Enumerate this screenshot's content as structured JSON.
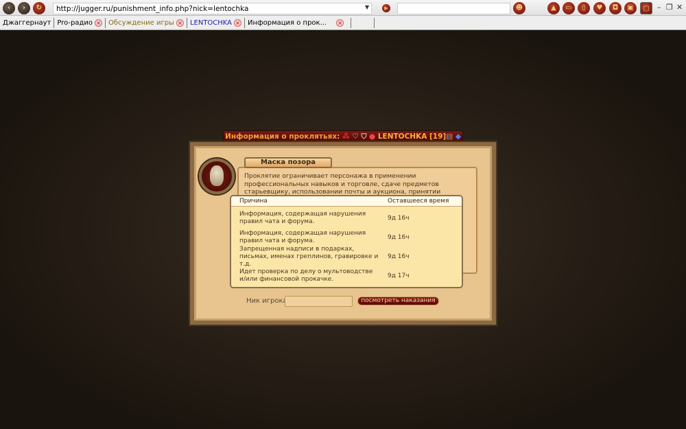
{
  "browser": {
    "url": "http://jugger.ru/punishment_info.php?nick=lentochka",
    "search_value": "",
    "tabs": [
      {
        "label": "Джаггернаут",
        "color": "#000000",
        "closable": false
      },
      {
        "label": "Pro-радио",
        "color": "#000000",
        "closable": true
      },
      {
        "label": "Обсуждение игры",
        "color": "#8a6a10",
        "closable": true
      },
      {
        "label": "LENTOCHKA",
        "color": "#2020b0",
        "closable": true
      },
      {
        "label": "Информация о прок...",
        "color": "#000000",
        "closable": true
      }
    ]
  },
  "dialog": {
    "title": "Информация о проклятьях:",
    "nick": "LENTOCHKA [19]",
    "curse_name": "Маска позора",
    "description": "Проклятие ограничивает персонажа в применении профессиональных навыков и торговле, сдаче предметов старьевщику, использовании почты и аукциона, принятии приглашения в группу. Снять проклятие можно в темнице.",
    "table": {
      "headers": [
        "Причина",
        "Оставшееся время"
      ],
      "rows": [
        {
          "reason": "Информация, содержащая нарушения правил чата и форума.",
          "time": "9д 16ч"
        },
        {
          "reason": "Информация, содержащая нарушения правил чата и форума.",
          "time": "9д 16ч"
        },
        {
          "reason": "Запрещенная надписи в подарках, письмах, именах греплинов, гравировке и т.д.",
          "time": "9д 16ч"
        },
        {
          "reason": "Идет проверка по делу о мультоводстве и/или финансовой прокачке.",
          "time": "9д 17ч"
        }
      ]
    },
    "nick_label": "Ник игрока",
    "nick_value": "",
    "view_button": "посмотреть наказания"
  }
}
